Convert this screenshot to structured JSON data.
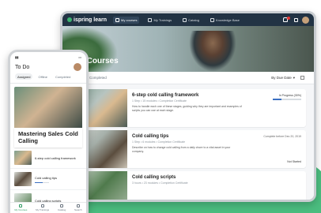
{
  "desktop": {
    "logo": "ispring learn",
    "nav": [
      {
        "label": "My courses",
        "active": true
      },
      {
        "label": "My Trainings",
        "active": false
      },
      {
        "label": "Catalog",
        "active": false
      },
      {
        "label": "Knowledge Base",
        "active": false
      }
    ],
    "hero_title": "My Courses",
    "filters": {
      "tab_1": "",
      "tab_2": "Completed",
      "sort": "By Due Date"
    },
    "courses": [
      {
        "title": "6-step cold calling framework",
        "meta": "1 Step • 15 modules • Completion Certificate",
        "desc": "How to handle each one of these stages, guiding why they are important and examples of scripts you can use at each stage.",
        "status": "In Progress (30%)",
        "progress": 0.3
      },
      {
        "title": "Cold calling tips",
        "meta": "1 Step • 6 modules • Completion Certificate",
        "desc": "Describe on how to change cold calling from a daily chore to a vital asset in your company.",
        "status": "Complete before Dec 20, 2019",
        "status_bottom": "Not Started"
      },
      {
        "title": "Cold calling scripts",
        "meta": "3 hours • 23 modules • Completion Certificate",
        "desc": "",
        "status": ""
      }
    ]
  },
  "mobile": {
    "title": "To Do",
    "tabs": [
      "Assigned",
      "Offline",
      "Completed"
    ],
    "hero_title": "Mastering Sales Cold Calling",
    "items": [
      {
        "title": "6-step cold calling framework",
        "progress": null
      },
      {
        "title": "Cold calling tips",
        "progress": 0.55
      },
      {
        "title": "Cold calling scripts",
        "progress": null
      }
    ],
    "nav": [
      {
        "label": "My Courses",
        "active": true
      },
      {
        "label": "My Trainings",
        "active": false
      },
      {
        "label": "Catalog",
        "active": false
      },
      {
        "label": "Search",
        "active": false
      }
    ]
  },
  "colors": {
    "accent": "#2d9a62",
    "topbar": "#223344",
    "progress": "#3b6fc2"
  }
}
